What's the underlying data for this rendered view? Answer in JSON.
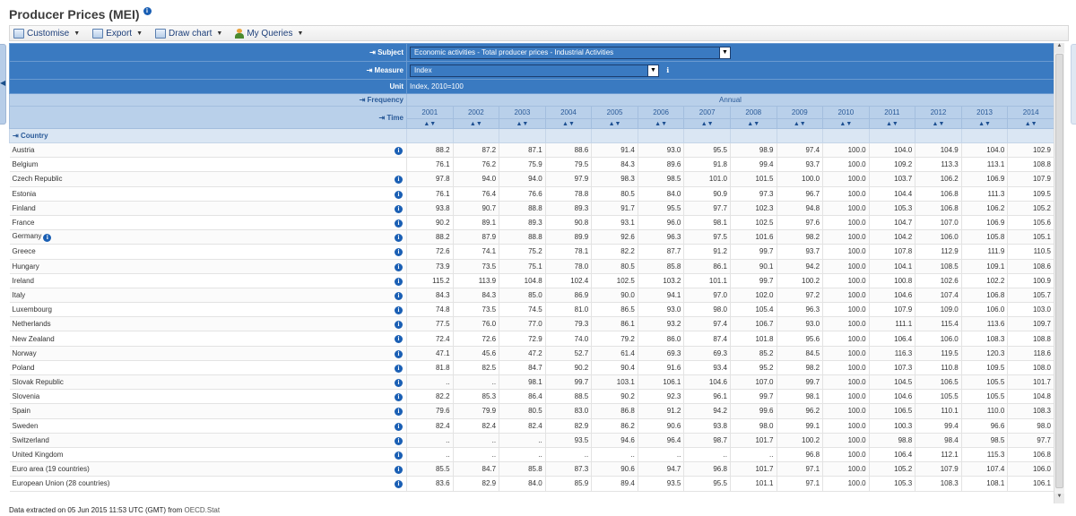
{
  "page": {
    "title": "Producer Prices (MEI)"
  },
  "toolbar": {
    "customise": "Customise",
    "export": "Export",
    "draw_chart": "Draw chart",
    "my_queries": "My Queries"
  },
  "filters": {
    "subject_label": "Subject",
    "subject_value": "Economic activities - Total producer prices - Industrial Activities",
    "measure_label": "Measure",
    "measure_value": "Index",
    "unit_label": "Unit",
    "unit_value": "Index, 2010=100",
    "frequency_label": "Frequency",
    "frequency_value": "Annual",
    "time_label": "Time",
    "country_label": "Country"
  },
  "years": [
    "2001",
    "2002",
    "2003",
    "2004",
    "2005",
    "2006",
    "2007",
    "2008",
    "2009",
    "2010",
    "2011",
    "2012",
    "2013",
    "2014"
  ],
  "rows": [
    {
      "country": "Austria",
      "info": true,
      "inline_info": false,
      "values": [
        "88.2",
        "87.2",
        "87.1",
        "88.6",
        "91.4",
        "93.0",
        "95.5",
        "98.9",
        "97.4",
        "100.0",
        "104.0",
        "104.9",
        "104.0",
        "102.9"
      ]
    },
    {
      "country": "Belgium",
      "info": false,
      "inline_info": false,
      "values": [
        "76.1",
        "76.2",
        "75.9",
        "79.5",
        "84.3",
        "89.6",
        "91.8",
        "99.4",
        "93.7",
        "100.0",
        "109.2",
        "113.3",
        "113.1",
        "108.8"
      ]
    },
    {
      "country": "Czech Republic",
      "info": true,
      "inline_info": false,
      "values": [
        "97.8",
        "94.0",
        "94.0",
        "97.9",
        "98.3",
        "98.5",
        "101.0",
        "101.5",
        "100.0",
        "100.0",
        "103.7",
        "106.2",
        "106.9",
        "107.9"
      ]
    },
    {
      "country": "Estonia",
      "info": true,
      "inline_info": false,
      "values": [
        "76.1",
        "76.4",
        "76.6",
        "78.8",
        "80.5",
        "84.0",
        "90.9",
        "97.3",
        "96.7",
        "100.0",
        "104.4",
        "106.8",
        "111.3",
        "109.5"
      ]
    },
    {
      "country": "Finland",
      "info": true,
      "inline_info": false,
      "values": [
        "93.8",
        "90.7",
        "88.8",
        "89.3",
        "91.7",
        "95.5",
        "97.7",
        "102.3",
        "94.8",
        "100.0",
        "105.3",
        "106.8",
        "106.2",
        "105.2"
      ]
    },
    {
      "country": "France",
      "info": true,
      "inline_info": false,
      "values": [
        "90.2",
        "89.1",
        "89.3",
        "90.8",
        "93.1",
        "96.0",
        "98.1",
        "102.5",
        "97.6",
        "100.0",
        "104.7",
        "107.0",
        "106.9",
        "105.6"
      ]
    },
    {
      "country": "Germany",
      "info": true,
      "inline_info": true,
      "values": [
        "88.2",
        "87.9",
        "88.8",
        "89.9",
        "92.6",
        "96.3",
        "97.5",
        "101.6",
        "98.2",
        "100.0",
        "104.2",
        "106.0",
        "105.8",
        "105.1"
      ]
    },
    {
      "country": "Greece",
      "info": true,
      "inline_info": false,
      "values": [
        "72.6",
        "74.1",
        "75.2",
        "78.1",
        "82.2",
        "87.7",
        "91.2",
        "99.7",
        "93.7",
        "100.0",
        "107.8",
        "112.9",
        "111.9",
        "110.5"
      ]
    },
    {
      "country": "Hungary",
      "info": true,
      "inline_info": false,
      "values": [
        "73.9",
        "73.5",
        "75.1",
        "78.0",
        "80.5",
        "85.8",
        "86.1",
        "90.1",
        "94.2",
        "100.0",
        "104.1",
        "108.5",
        "109.1",
        "108.6"
      ]
    },
    {
      "country": "Ireland",
      "info": true,
      "inline_info": false,
      "values": [
        "115.2",
        "113.9",
        "104.8",
        "102.4",
        "102.5",
        "103.2",
        "101.1",
        "99.7",
        "100.2",
        "100.0",
        "100.8",
        "102.6",
        "102.2",
        "100.9"
      ]
    },
    {
      "country": "Italy",
      "info": true,
      "inline_info": false,
      "values": [
        "84.3",
        "84.3",
        "85.0",
        "86.9",
        "90.0",
        "94.1",
        "97.0",
        "102.0",
        "97.2",
        "100.0",
        "104.6",
        "107.4",
        "106.8",
        "105.7"
      ]
    },
    {
      "country": "Luxembourg",
      "info": true,
      "inline_info": false,
      "values": [
        "74.8",
        "73.5",
        "74.5",
        "81.0",
        "86.5",
        "93.0",
        "98.0",
        "105.4",
        "96.3",
        "100.0",
        "107.9",
        "109.0",
        "106.0",
        "103.0"
      ]
    },
    {
      "country": "Netherlands",
      "info": true,
      "inline_info": false,
      "values": [
        "77.5",
        "76.0",
        "77.0",
        "79.3",
        "86.1",
        "93.2",
        "97.4",
        "106.7",
        "93.0",
        "100.0",
        "111.1",
        "115.4",
        "113.6",
        "109.7"
      ]
    },
    {
      "country": "New Zealand",
      "info": true,
      "inline_info": false,
      "values": [
        "72.4",
        "72.6",
        "72.9",
        "74.0",
        "79.2",
        "86.0",
        "87.4",
        "101.8",
        "95.6",
        "100.0",
        "106.4",
        "106.0",
        "108.3",
        "108.8"
      ]
    },
    {
      "country": "Norway",
      "info": true,
      "inline_info": false,
      "values": [
        "47.1",
        "45.6",
        "47.2",
        "52.7",
        "61.4",
        "69.3",
        "69.3",
        "85.2",
        "84.5",
        "100.0",
        "116.3",
        "119.5",
        "120.3",
        "118.6"
      ]
    },
    {
      "country": "Poland",
      "info": true,
      "inline_info": false,
      "values": [
        "81.8",
        "82.5",
        "84.7",
        "90.2",
        "90.4",
        "91.6",
        "93.4",
        "95.2",
        "98.2",
        "100.0",
        "107.3",
        "110.8",
        "109.5",
        "108.0"
      ]
    },
    {
      "country": "Slovak Republic",
      "info": true,
      "inline_info": false,
      "values": [
        "..",
        "..",
        "98.1",
        "99.7",
        "103.1",
        "106.1",
        "104.6",
        "107.0",
        "99.7",
        "100.0",
        "104.5",
        "106.5",
        "105.5",
        "101.7"
      ]
    },
    {
      "country": "Slovenia",
      "info": true,
      "inline_info": false,
      "values": [
        "82.2",
        "85.3",
        "86.4",
        "88.5",
        "90.2",
        "92.3",
        "96.1",
        "99.7",
        "98.1",
        "100.0",
        "104.6",
        "105.5",
        "105.5",
        "104.8"
      ]
    },
    {
      "country": "Spain",
      "info": true,
      "inline_info": false,
      "values": [
        "79.6",
        "79.9",
        "80.5",
        "83.0",
        "86.8",
        "91.2",
        "94.2",
        "99.6",
        "96.2",
        "100.0",
        "106.5",
        "110.1",
        "110.0",
        "108.3"
      ]
    },
    {
      "country": "Sweden",
      "info": true,
      "inline_info": false,
      "values": [
        "82.4",
        "82.4",
        "82.4",
        "82.9",
        "86.2",
        "90.6",
        "93.8",
        "98.0",
        "99.1",
        "100.0",
        "100.3",
        "99.4",
        "96.6",
        "98.0"
      ]
    },
    {
      "country": "Switzerland",
      "info": true,
      "inline_info": false,
      "values": [
        "..",
        "..",
        "..",
        "93.5",
        "94.6",
        "96.4",
        "98.7",
        "101.7",
        "100.2",
        "100.0",
        "98.8",
        "98.4",
        "98.5",
        "97.7"
      ]
    },
    {
      "country": "United Kingdom",
      "info": true,
      "inline_info": false,
      "values": [
        "..",
        "..",
        "..",
        "..",
        "..",
        "..",
        "..",
        "..",
        "96.8",
        "100.0",
        "106.4",
        "112.1",
        "115.3",
        "106.8"
      ]
    },
    {
      "country": "Euro area (19 countries)",
      "info": true,
      "inline_info": false,
      "values": [
        "85.5",
        "84.7",
        "85.8",
        "87.3",
        "90.6",
        "94.7",
        "96.8",
        "101.7",
        "97.1",
        "100.0",
        "105.2",
        "107.9",
        "107.4",
        "106.0"
      ]
    },
    {
      "country": "European Union (28 countries)",
      "info": true,
      "inline_info": false,
      "values": [
        "83.6",
        "82.9",
        "84.0",
        "85.9",
        "89.4",
        "93.5",
        "95.5",
        "101.1",
        "97.1",
        "100.0",
        "105.3",
        "108.3",
        "108.1",
        "106.1"
      ]
    }
  ],
  "footer": {
    "text": "Data extracted on 05 Jun 2015 11:53 UTC (GMT) from",
    "source": "OECD.Stat"
  },
  "colors": {
    "header_blue": "#3a7ac1",
    "header_light": "#b9d0ea",
    "info_blue": "#1a5fb4"
  }
}
